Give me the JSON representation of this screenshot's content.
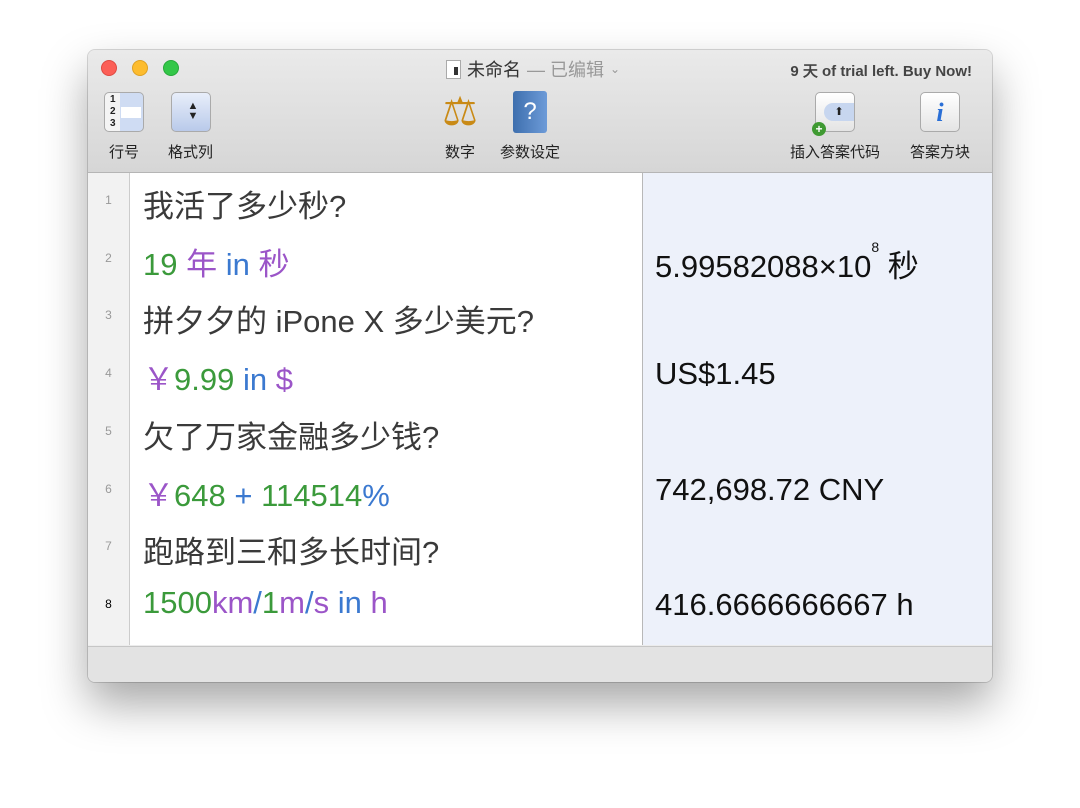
{
  "window": {
    "title": "未命名",
    "edited": "— 已编辑",
    "trial_text": "9 天 of trial left. Buy Now!"
  },
  "toolbar": {
    "line_numbers": "行号",
    "format_column": "格式列",
    "numbers": "数字",
    "settings": "参数设定",
    "insert_answer_code": "插入答案代码",
    "answer_block": "答案方块"
  },
  "lines": [
    {
      "n": "1",
      "segments": [
        {
          "t": "我活了多少秒?",
          "c": "t"
        }
      ],
      "answer": ""
    },
    {
      "n": "2",
      "segments": [
        {
          "t": "19 ",
          "c": "g"
        },
        {
          "t": "年 ",
          "c": "p"
        },
        {
          "t": "in ",
          "c": "b"
        },
        {
          "t": "秒",
          "c": "p"
        }
      ],
      "answer": "5.99582088×10",
      "answer_sup": "8",
      "answer_suffix": " 秒"
    },
    {
      "n": "3",
      "segments": [
        {
          "t": "拼夕夕的 iPone X 多少美元?",
          "c": "t"
        }
      ],
      "answer": ""
    },
    {
      "n": "4",
      "segments": [
        {
          "t": "￥",
          "c": "p"
        },
        {
          "t": "9.99 ",
          "c": "g"
        },
        {
          "t": "in ",
          "c": "b"
        },
        {
          "t": "$",
          "c": "p"
        }
      ],
      "answer": "US$1.45"
    },
    {
      "n": "5",
      "segments": [
        {
          "t": "欠了万家金融多少钱?",
          "c": "t"
        }
      ],
      "answer": ""
    },
    {
      "n": "6",
      "segments": [
        {
          "t": "￥",
          "c": "p"
        },
        {
          "t": "648 ",
          "c": "g"
        },
        {
          "t": "+ ",
          "c": "b"
        },
        {
          "t": "114514",
          "c": "g"
        },
        {
          "t": "%",
          "c": "b"
        }
      ],
      "answer": "742,698.72 CNY"
    },
    {
      "n": "7",
      "segments": [
        {
          "t": "跑路到三和多长时间?",
          "c": "t"
        }
      ],
      "answer": ""
    },
    {
      "n": "8",
      "segments": [
        {
          "t": "1500",
          "c": "g"
        },
        {
          "t": "km",
          "c": "p"
        },
        {
          "t": "/",
          "c": "b"
        },
        {
          "t": "1",
          "c": "g"
        },
        {
          "t": "m",
          "c": "p"
        },
        {
          "t": "/",
          "c": "b"
        },
        {
          "t": "s ",
          "c": "p"
        },
        {
          "t": "in ",
          "c": "b"
        },
        {
          "t": "h",
          "c": "p"
        }
      ],
      "answer": "416.6666666667 h"
    }
  ],
  "current_line": "8",
  "colors": {
    "number": "#3b9a3b",
    "unit": "#9b55c8",
    "operator": "#3b79d0"
  }
}
